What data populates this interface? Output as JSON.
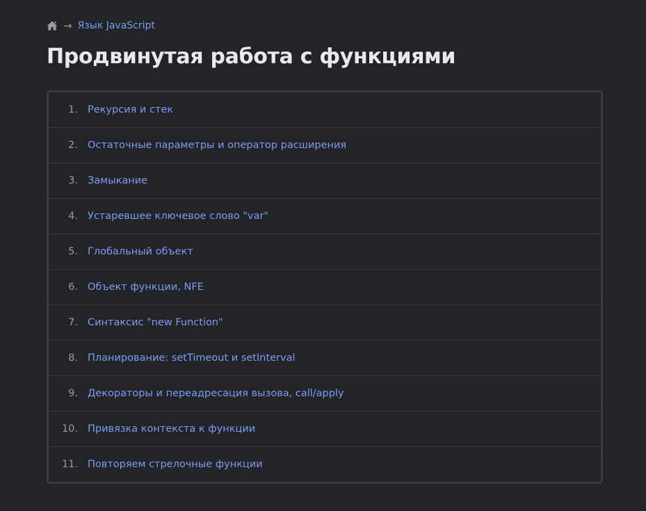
{
  "breadcrumb": {
    "home_icon": "home-icon",
    "separator": "→",
    "parent": "Язык JavaScript"
  },
  "title": "Продвинутая работа с функциями",
  "items": [
    {
      "num": "1.",
      "label": "Рекурсия и стек"
    },
    {
      "num": "2.",
      "label": "Остаточные параметры и оператор расширения"
    },
    {
      "num": "3.",
      "label": "Замыкание"
    },
    {
      "num": "4.",
      "label": "Устаревшее ключевое слово \"var\""
    },
    {
      "num": "5.",
      "label": "Глобальный объект"
    },
    {
      "num": "6.",
      "label": "Объект функции, NFE"
    },
    {
      "num": "7.",
      "label": "Синтаксис \"new Function\""
    },
    {
      "num": "8.",
      "label": "Планирование: setTimeout и setInterval"
    },
    {
      "num": "9.",
      "label": "Декораторы и переадресация вызова, call/apply"
    },
    {
      "num": "10.",
      "label": "Привязка контекста к функции"
    },
    {
      "num": "11.",
      "label": "Повторяем стрелочные функции"
    }
  ],
  "colors": {
    "background": "#232428",
    "link": "#7d9cf0",
    "border": "#3a3b40",
    "title": "#e8e9ec"
  }
}
